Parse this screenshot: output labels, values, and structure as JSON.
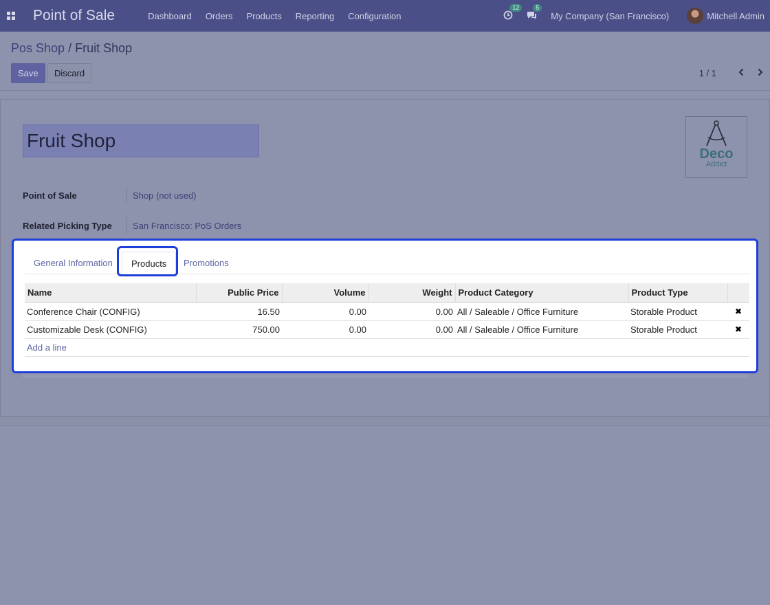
{
  "navbar": {
    "app_title": "Point of Sale",
    "menu": [
      "Dashboard",
      "Orders",
      "Products",
      "Reporting",
      "Configuration"
    ],
    "activity_count": "12",
    "message_count": "5",
    "company": "My Company (San Francisco)",
    "user": "Mitchell Admin"
  },
  "breadcrumb": {
    "parent": "Pos Shop",
    "separator": "/",
    "current": "Fruit Shop"
  },
  "buttons": {
    "save": "Save",
    "discard": "Discard"
  },
  "pager": {
    "value": "1 / 1"
  },
  "form": {
    "name": "Fruit Shop",
    "logo": {
      "name": "Deco",
      "sub": "Addict"
    },
    "fields": [
      {
        "label": "Point of Sale",
        "value": "Shop (not used)"
      },
      {
        "label": "Related Picking Type",
        "value": "San Francisco: PoS Orders"
      }
    ]
  },
  "notebook": {
    "tabs": [
      "General Information",
      "Products",
      "Promotions"
    ],
    "active_tab": "Products",
    "columns": [
      "Name",
      "Public Price",
      "Volume",
      "Weight",
      "Product Category",
      "Product Type"
    ],
    "rows": [
      {
        "name": "Conference Chair (CONFIG)",
        "price": "16.50",
        "volume": "0.00",
        "weight": "0.00",
        "category": "All / Saleable / Office Furniture",
        "type": "Storable Product"
      },
      {
        "name": "Customizable Desk (CONFIG)",
        "price": "750.00",
        "volume": "0.00",
        "weight": "0.00",
        "category": "All / Saleable / Office Furniture",
        "type": "Storable Product"
      }
    ],
    "add_line": "Add a line"
  },
  "colors": {
    "navbar": "#4a4f87",
    "focus_outline": "#1d3fd8",
    "link": "#5d65a3"
  }
}
